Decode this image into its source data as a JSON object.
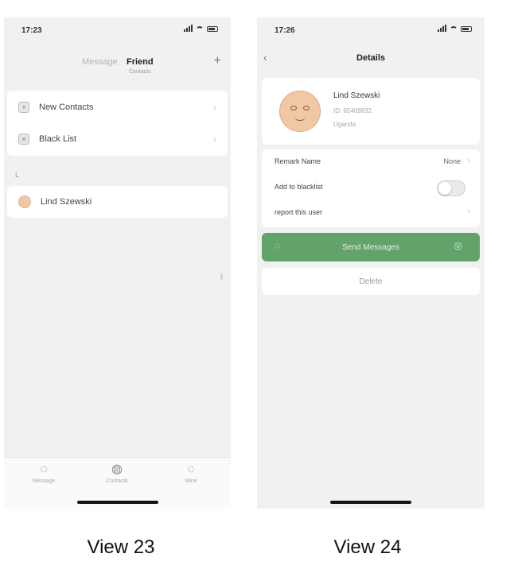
{
  "captions": {
    "left": "View 23",
    "right": "View 24"
  },
  "view23": {
    "status": {
      "time": "17:23"
    },
    "tabs": {
      "other": "Message",
      "active": "Friend",
      "active_sub": "Contacts",
      "add_icon": "+"
    },
    "menu": [
      {
        "label": "New Contacts",
        "icon": "add-person-icon"
      },
      {
        "label": "Black List",
        "icon": "blocked-icon"
      }
    ],
    "section_letter": "L",
    "contact": {
      "label": "Lind Szewski"
    },
    "tabbar": [
      {
        "caption": "Message",
        "icon": "chat-icon",
        "glyph": "◌"
      },
      {
        "caption": "Contacts",
        "icon": "contacts-icon",
        "glyph": "◍"
      },
      {
        "caption": "Mine",
        "icon": "mine-icon",
        "glyph": "◌"
      }
    ]
  },
  "view24": {
    "status": {
      "time": "17:26"
    },
    "title": "Details",
    "profile": {
      "name": "Lind Szewski",
      "id": "ID: 65409832",
      "region": "Uganda"
    },
    "rows": {
      "remark_label": "Remark Name",
      "remark_value": "None",
      "blacklist_label": "Add to blacklist",
      "report_label": "report this user"
    },
    "send_button": "Send Messages",
    "delete_button": "Delete",
    "accent_color": "#63a36b"
  }
}
